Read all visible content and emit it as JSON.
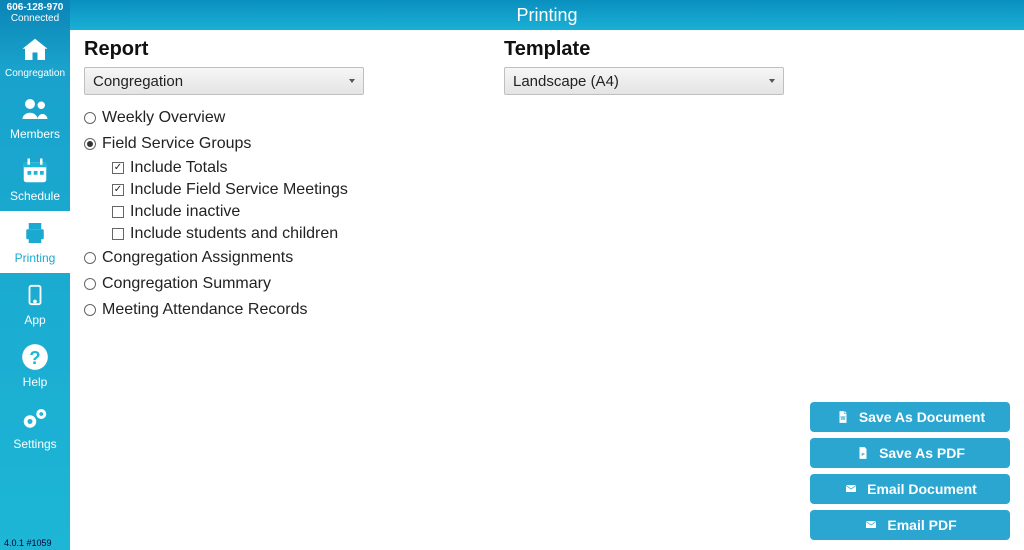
{
  "header": {
    "title": "Printing",
    "connection_code": "606-128-970",
    "connection_status": "Connected",
    "version_footer": "4.0.1 #1059"
  },
  "sidebar": {
    "items": [
      {
        "id": "congregation",
        "label": "Congregation"
      },
      {
        "id": "members",
        "label": "Members"
      },
      {
        "id": "schedule",
        "label": "Schedule"
      },
      {
        "id": "printing",
        "label": "Printing"
      },
      {
        "id": "app",
        "label": "App"
      },
      {
        "id": "help",
        "label": "Help"
      },
      {
        "id": "settings",
        "label": "Settings"
      }
    ],
    "active_id": "printing"
  },
  "report": {
    "section_label": "Report",
    "dropdown_value": "Congregation",
    "options": [
      {
        "id": "weekly_overview",
        "label": "Weekly Overview",
        "selected": false
      },
      {
        "id": "field_service_groups",
        "label": "Field Service Groups",
        "selected": true,
        "suboptions": [
          {
            "id": "include_totals",
            "label": "Include Totals",
            "checked": true
          },
          {
            "id": "include_fs_meetings",
            "label": "Include Field Service Meetings",
            "checked": true
          },
          {
            "id": "include_inactive",
            "label": "Include inactive",
            "checked": false
          },
          {
            "id": "include_students",
            "label": "Include students and children",
            "checked": false
          }
        ]
      },
      {
        "id": "cong_assignments",
        "label": "Congregation Assignments",
        "selected": false
      },
      {
        "id": "cong_summary",
        "label": "Congregation Summary",
        "selected": false
      },
      {
        "id": "meeting_att",
        "label": "Meeting Attendance Records",
        "selected": false
      }
    ]
  },
  "template": {
    "section_label": "Template",
    "dropdown_value": "Landscape (A4)"
  },
  "actions": {
    "save_as_document": "Save As Document",
    "save_as_pdf": "Save As PDF",
    "email_document": "Email Document",
    "email_pdf": "Email PDF"
  }
}
